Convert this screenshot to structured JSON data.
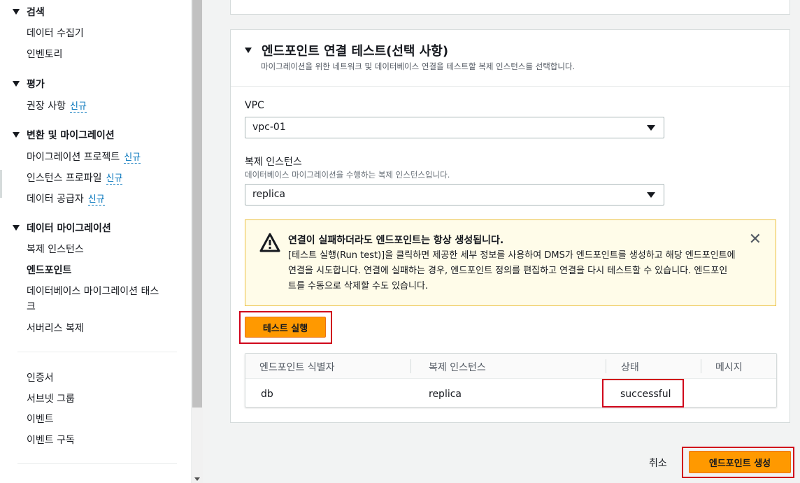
{
  "sidebar": {
    "sections": [
      {
        "label": "검색",
        "items": [
          {
            "label": "데이터 수집기"
          },
          {
            "label": "인벤토리"
          }
        ]
      },
      {
        "label": "평가",
        "items": [
          {
            "label": "권장 사항",
            "badge": "신규"
          }
        ]
      },
      {
        "label": "변환 및 마이그레이션",
        "items": [
          {
            "label": "마이그레이션 프로젝트",
            "badge": "신규"
          },
          {
            "label": "인스턴스 프로파일",
            "badge": "신규"
          },
          {
            "label": "데이터 공급자",
            "badge": "신규"
          }
        ]
      },
      {
        "label": "데이터 마이그레이션",
        "items": [
          {
            "label": "복제 인스턴스"
          },
          {
            "label": "엔드포인트",
            "active": true
          },
          {
            "label_line1": "데이터베이스 마이그레이션 태스",
            "label_line2": "크"
          },
          {
            "label": "서버리스 복제"
          }
        ]
      }
    ],
    "extra_items": [
      "인증서",
      "서브넷 그룹",
      "이벤트",
      "이벤트 구독"
    ]
  },
  "panel": {
    "title": "엔드포인트 연결 테스트(선택 사항)",
    "description": "마이그레이션을 위한 네트워크 및 데이터베이스 연결을 테스트할 복제 인스턴스를 선택합니다.",
    "vpc": {
      "label": "VPC",
      "value": "vpc-01"
    },
    "replica": {
      "label": "복제 인스턴스",
      "description": "데이터베이스 마이그레이션을 수행하는 복제 인스턴스입니다.",
      "value": "replica"
    },
    "warning": {
      "title": "연결이 실패하더라도 엔드포인트는 항상 생성됩니다.",
      "body": "[테스트 실행(Run test)]을 클릭하면 제공한 세부 정보를 사용하여 DMS가 엔드포인트를 생성하고 해당 엔드포인트에 연결을 시도합니다. 연결에 실패하는 경우, 엔드포인트 정의를 편집하고 연결을 다시 테스트할 수 있습니다. 엔드포인트를 수동으로 삭제할 수도 있습니다.",
      "close_icon": "close-icon"
    },
    "test_button": "테스트 실행",
    "table": {
      "columns": [
        "엔드포인트 식별자",
        "복제 인스턴스",
        "상태",
        "메시지"
      ],
      "rows": [
        {
          "endpoint_id": "db",
          "replica": "replica",
          "status": "successful",
          "message": ""
        }
      ]
    }
  },
  "footer": {
    "cancel": "취소",
    "create": "엔드포인트 생성"
  },
  "colors": {
    "primary": "#ff9900",
    "link": "#0073bb",
    "highlight": "#d0021b",
    "warning_bg": "#fffce9"
  }
}
